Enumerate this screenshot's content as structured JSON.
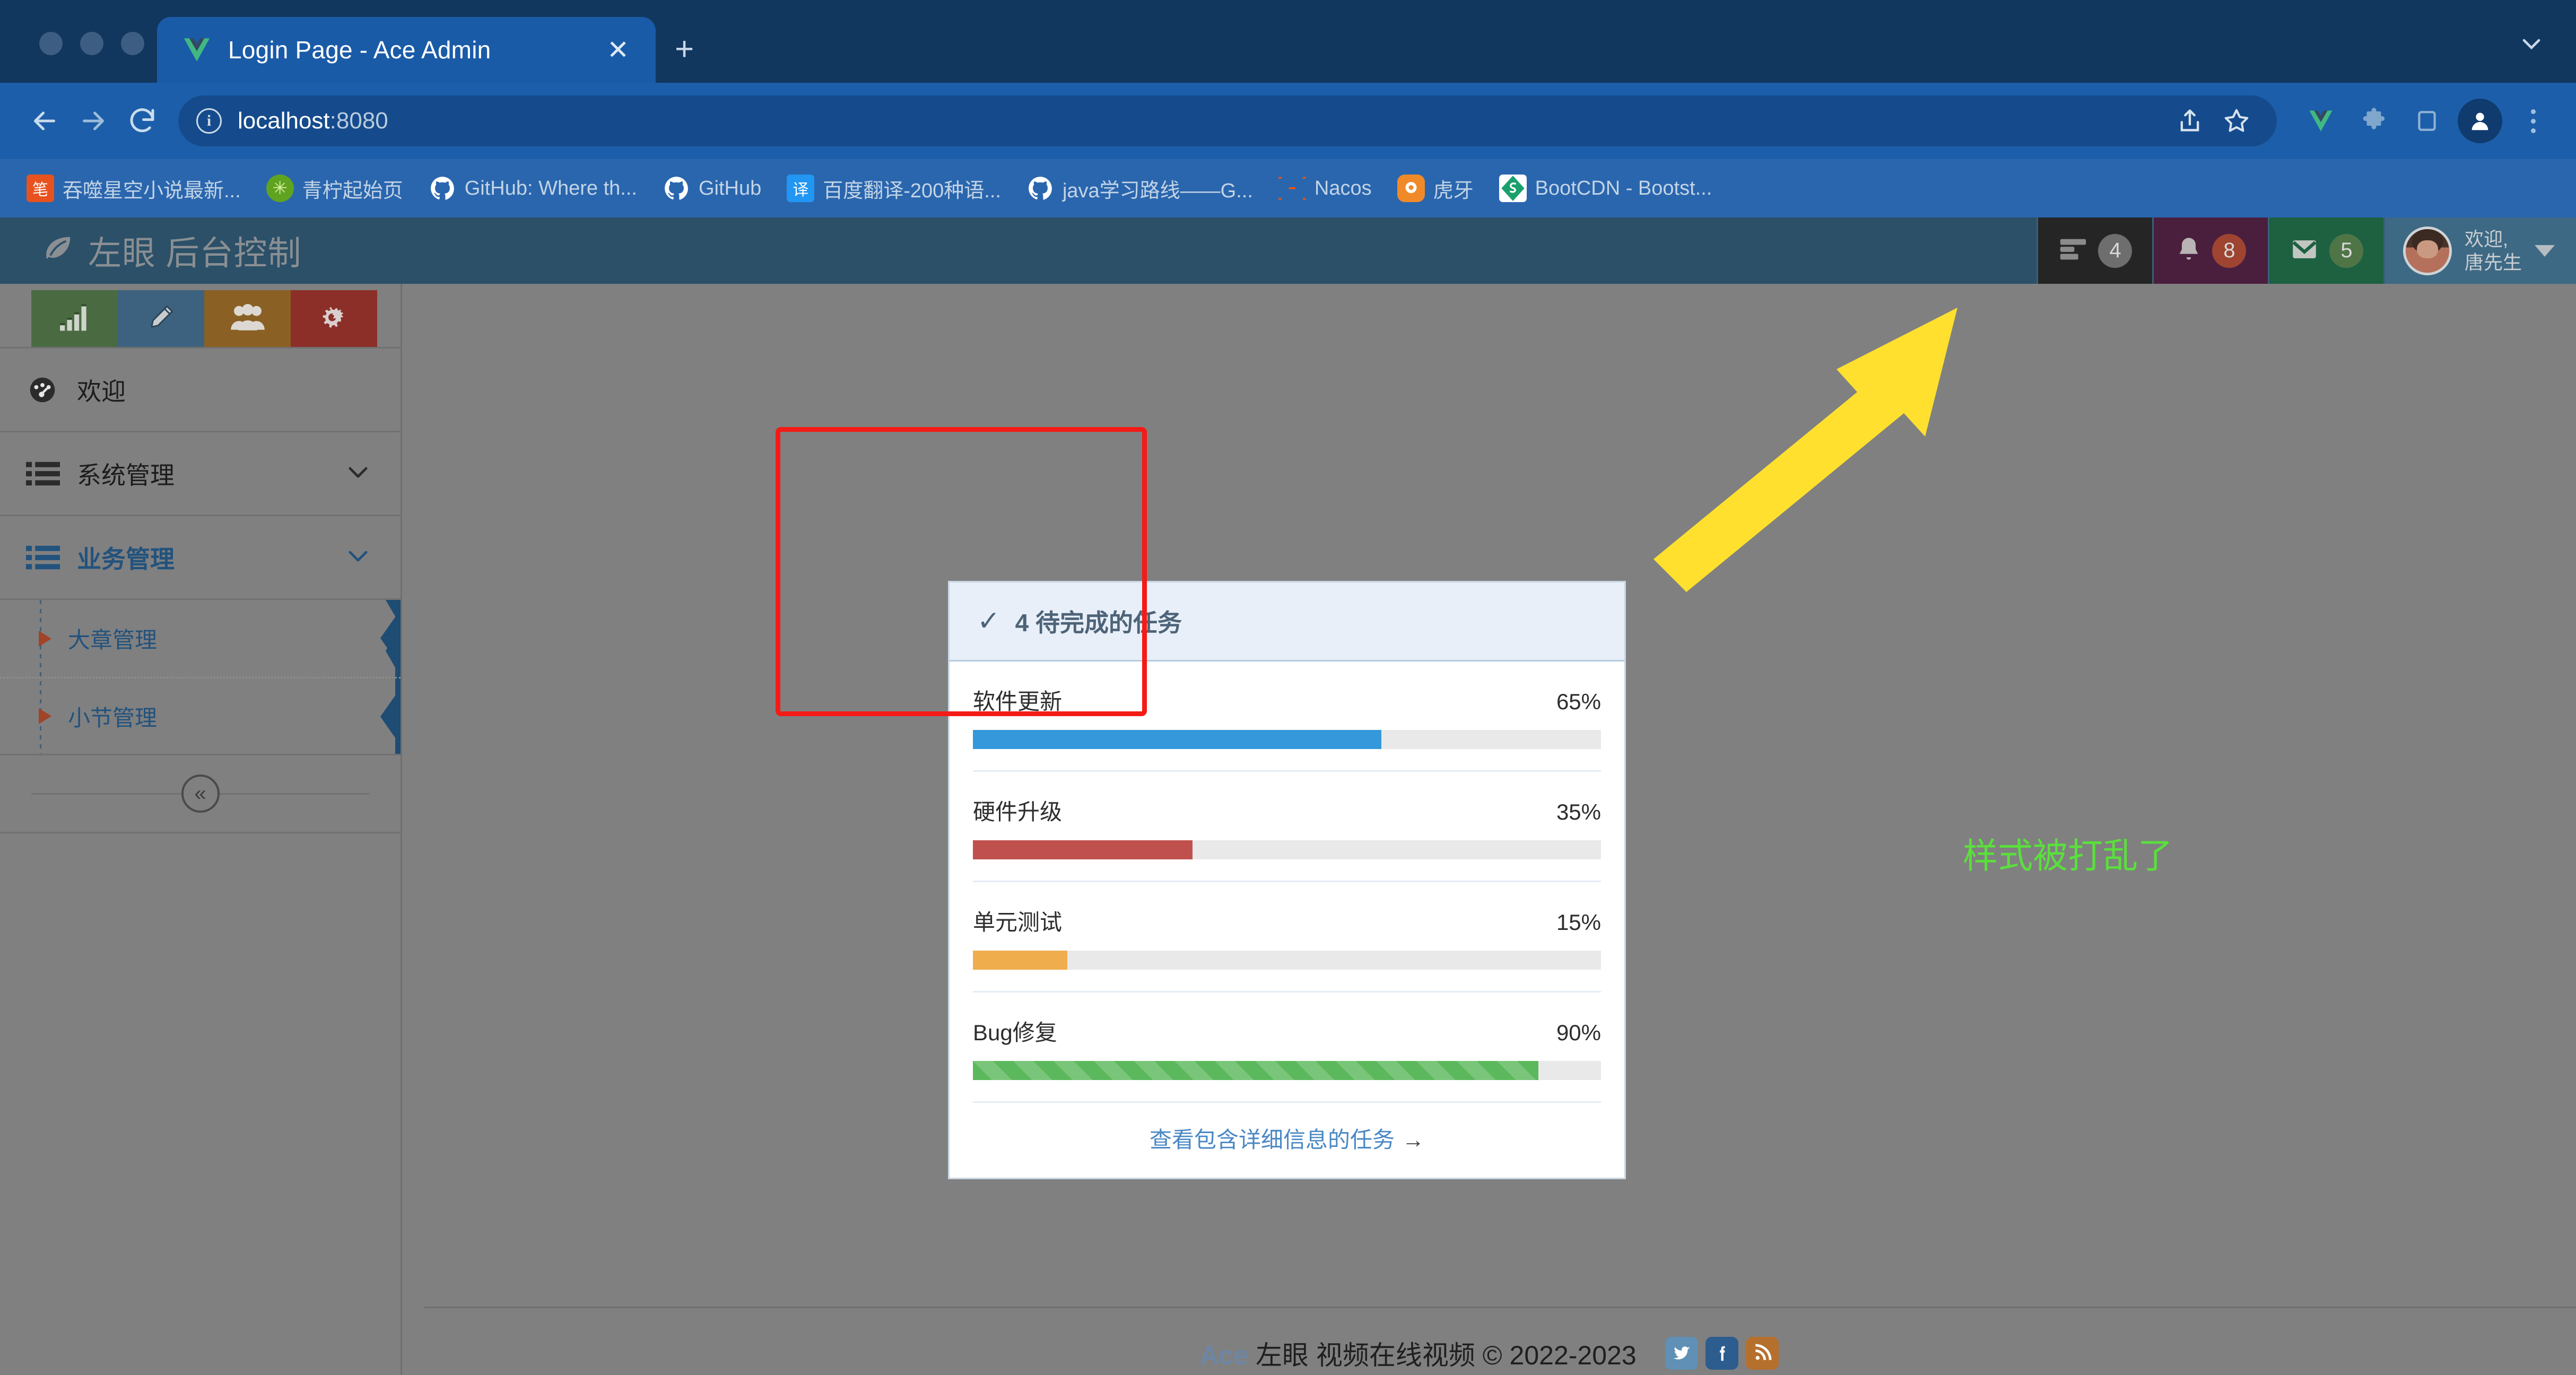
{
  "browser": {
    "tab": {
      "title": "Login Page - Ace Admin",
      "favicon": "vue-logo-icon",
      "close_label": "✕"
    },
    "new_tab_label": "+",
    "nav": {
      "back": "←",
      "forward": "→",
      "reload": "↻"
    },
    "omnibox": {
      "url_main": "localhost",
      "url_port": ":8080",
      "info_icon": "i"
    },
    "toolbar_icons": [
      "share-icon",
      "bookmark-star-icon",
      "vue-devtools-icon",
      "extensions-puzzle-icon",
      "sidepanel-icon",
      "profile-avatar-icon",
      "chrome-menu-kebab-icon"
    ],
    "bookmarks": [
      {
        "label": "吞噬星空小说最新...",
        "icon": "笔",
        "icon_bg": "#e8521e",
        "icon_fg": "#ffffff"
      },
      {
        "label": "青柠起始页",
        "icon": "✳",
        "icon_bg": "#5fa321",
        "icon_fg": "#d8f0a0"
      },
      {
        "label": "GitHub: Where th...",
        "icon": "●",
        "icon_bg": "transparent",
        "icon_fg": "#ffffff"
      },
      {
        "label": "GitHub",
        "icon": "●",
        "icon_bg": "transparent",
        "icon_fg": "#ffffff"
      },
      {
        "label": "百度翻译-200种语...",
        "icon": "译",
        "icon_bg": "#2196f3",
        "icon_fg": "#ffffff"
      },
      {
        "label": "java学习路线——G...",
        "icon": "●",
        "icon_bg": "transparent",
        "icon_fg": "#ffffff"
      },
      {
        "label": "Nacos",
        "icon": "◉",
        "icon_bg": "transparent",
        "icon_fg": "#f4520b"
      },
      {
        "label": "虎牙",
        "icon": "◉",
        "icon_bg": "transparent",
        "icon_fg": "#f08a28"
      },
      {
        "label": "BootCDN - Bootst...",
        "icon": "◆",
        "icon_bg": "#ffffff",
        "icon_fg": "#1aa06d"
      }
    ]
  },
  "app": {
    "brand": "左眼 后台控制",
    "brand_icon": "leaf-icon",
    "header_items": [
      {
        "name": "tasks",
        "icon": "tasks-list-icon",
        "count": "4"
      },
      {
        "name": "notifications",
        "icon": "bell-icon",
        "count": "8"
      },
      {
        "name": "messages",
        "icon": "envelope-icon",
        "count": "5"
      }
    ],
    "user": {
      "greeting": "欢迎,",
      "name": "唐先生"
    }
  },
  "sidebar": {
    "quick_actions": [
      {
        "name": "stats",
        "icon": "bar-chart-icon",
        "color": "#4a6b42"
      },
      {
        "name": "edit",
        "icon": "pencil-icon",
        "color": "#3d627f"
      },
      {
        "name": "users",
        "icon": "users-group-icon",
        "color": "#8a6024"
      },
      {
        "name": "settings",
        "icon": "cogs-icon",
        "color": "#8c2f28"
      }
    ],
    "items": [
      {
        "label": "欢迎",
        "icon": "dashboard-gauge-icon",
        "active": false,
        "expandable": false
      },
      {
        "label": "系统管理",
        "icon": "list-icon",
        "active": false,
        "expandable": true
      },
      {
        "label": "业务管理",
        "icon": "list-icon",
        "active": true,
        "expandable": true
      }
    ],
    "submenu": [
      {
        "label": "大章管理"
      },
      {
        "label": "小节管理"
      }
    ],
    "collapse_label": "«"
  },
  "task_card": {
    "header_count": "4",
    "header_title": "待完成的任务",
    "header_icon": "check-icon",
    "tasks": [
      {
        "name": "软件更新",
        "percent": "65%",
        "value": 65,
        "color": "#3498db",
        "striped": false
      },
      {
        "name": "硬件升级",
        "percent": "35%",
        "value": 35,
        "color": "#c0504d",
        "striped": false
      },
      {
        "name": "单元测试",
        "percent": "15%",
        "value": 15,
        "color": "#f0ad4e",
        "striped": false
      },
      {
        "name": "Bug修复",
        "percent": "90%",
        "value": 90,
        "color": "#5cb85c",
        "striped": true
      }
    ],
    "footer_link": "查看包含详细信息的任务",
    "footer_arrow": "→"
  },
  "footer": {
    "ace": "Ace",
    "text": "左眼 视频在线视频 © 2022-2023",
    "social": [
      {
        "name": "twitter",
        "glyph": "t",
        "color": "#6090b5"
      },
      {
        "name": "facebook",
        "glyph": "f",
        "color": "#2d5d8e"
      },
      {
        "name": "rss",
        "glyph": "◔",
        "color": "#b5702e"
      }
    ]
  },
  "annotations": {
    "rect_color": "#f41b16",
    "arrow_color": "#ffe02e",
    "note": "样式被打乱了",
    "note_color": "#5ae03c"
  }
}
